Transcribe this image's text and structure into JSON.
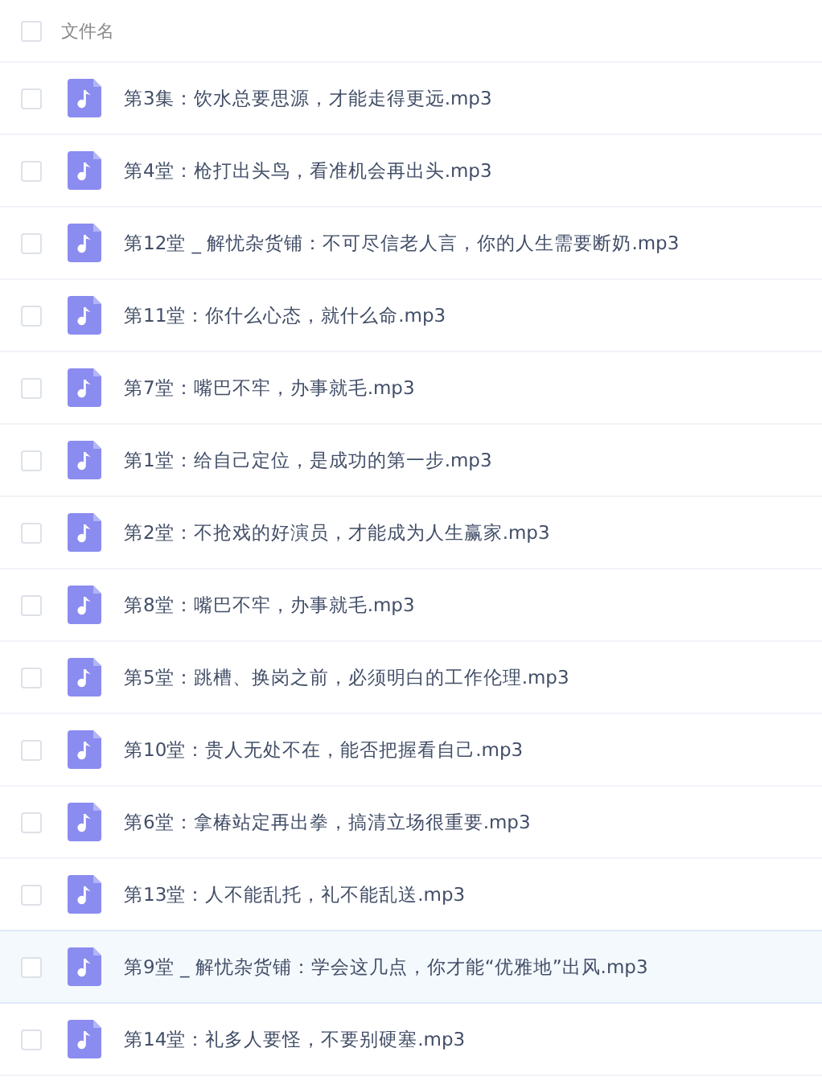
{
  "header": {
    "checked": false,
    "label": "文件名"
  },
  "files": [
    {
      "name": "第3集：饮水总要思源，才能走得更远.mp3",
      "checked": false,
      "hovered": false
    },
    {
      "name": "第4堂：枪打出头鸟，看准机会再出头.mp3",
      "checked": false,
      "hovered": false
    },
    {
      "name": "第12堂 _ 解忧杂货铺：不可尽信老人言，你的人生需要断奶.mp3",
      "checked": false,
      "hovered": false
    },
    {
      "name": "第11堂：你什么心态，就什么命.mp3",
      "checked": false,
      "hovered": false
    },
    {
      "name": "第7堂：嘴巴不牢，办事就毛.mp3",
      "checked": false,
      "hovered": false
    },
    {
      "name": "第1堂：给自己定位，是成功的第一步.mp3",
      "checked": false,
      "hovered": false
    },
    {
      "name": "第2堂：不抢戏的好演员，才能成为人生赢家.mp3",
      "checked": false,
      "hovered": false
    },
    {
      "name": "第8堂：嘴巴不牢，办事就毛.mp3",
      "checked": false,
      "hovered": false
    },
    {
      "name": "第5堂：跳槽、换岗之前，必须明白的工作伦理.mp3",
      "checked": false,
      "hovered": false
    },
    {
      "name": "第10堂：贵人无处不在，能否把握看自己.mp3",
      "checked": false,
      "hovered": false
    },
    {
      "name": "第6堂：拿椿站定再出拳，搞清立场很重要.mp3",
      "checked": false,
      "hovered": false
    },
    {
      "name": "第13堂：人不能乱托，礼不能乱送.mp3",
      "checked": false,
      "hovered": false
    },
    {
      "name": "第9堂 _ 解忧杂货铺：学会这几点，你才能“优雅地”出风.mp3",
      "checked": false,
      "hovered": true
    },
    {
      "name": "第14堂：礼多人要怪，不要别硬塞.mp3",
      "checked": false,
      "hovered": false
    }
  ]
}
